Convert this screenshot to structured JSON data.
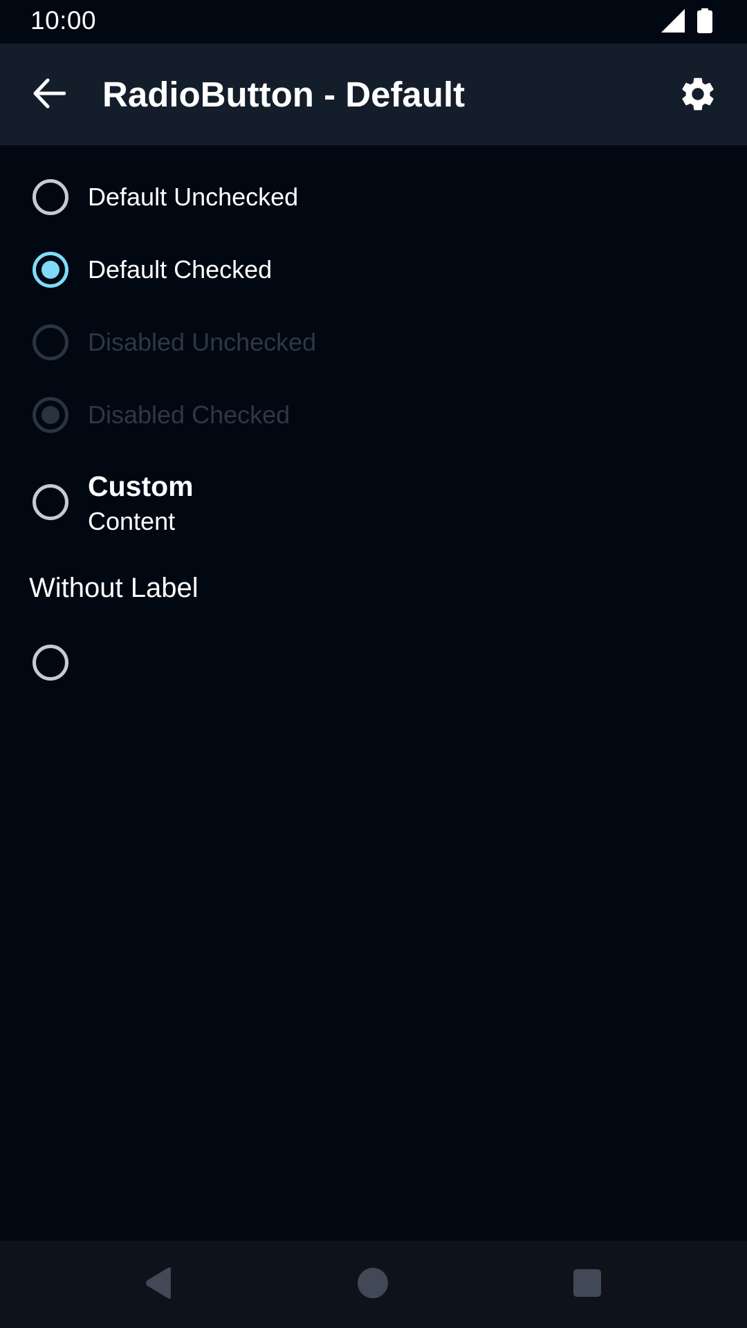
{
  "status_bar": {
    "time": "10:00",
    "icons": [
      "signal-icon",
      "battery-icon"
    ]
  },
  "app_bar": {
    "title": "RadioButton - Default",
    "back_icon": "arrow-back-icon",
    "settings_icon": "gear-icon"
  },
  "radios": [
    {
      "label": "Default Unchecked",
      "checked": false,
      "enabled": true
    },
    {
      "label": "Default Checked",
      "checked": true,
      "enabled": true
    },
    {
      "label": "Disabled Unchecked",
      "checked": false,
      "enabled": false
    },
    {
      "label": "Disabled Checked",
      "checked": true,
      "enabled": false
    }
  ],
  "custom_radio": {
    "title": "Custom",
    "subtitle": "Content",
    "checked": false
  },
  "without_label": {
    "heading": "Without Label",
    "checked": false
  },
  "colors": {
    "background": "#020812",
    "app_bar": "#141e2b",
    "accent": "#7fdcf8",
    "radio_border": "#c5cad3",
    "disabled": "#2a3340",
    "nav_bar": "#0e121a"
  },
  "nav_bar": {
    "icons": [
      "back-triangle-icon",
      "home-circle-icon",
      "recents-square-icon"
    ]
  }
}
